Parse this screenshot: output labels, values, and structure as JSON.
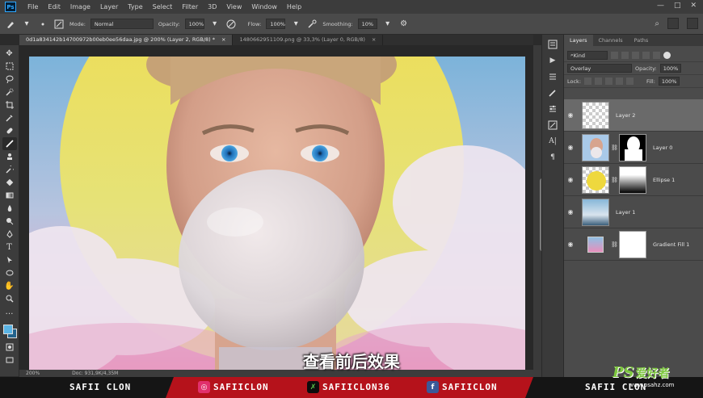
{
  "app": {
    "logo": "Ps"
  },
  "menu": [
    "File",
    "Edit",
    "Image",
    "Layer",
    "Type",
    "Select",
    "Filter",
    "3D",
    "View",
    "Window",
    "Help"
  ],
  "options": {
    "mode_label": "Mode:",
    "mode_value": "Normal",
    "opacity_label": "Opacity:",
    "opacity_value": "100%",
    "flow_label": "Flow:",
    "flow_value": "100%",
    "smoothing_label": "Smoothing:",
    "smoothing_value": "10%"
  },
  "tabs": [
    {
      "label": "0d1a834142b14700972b00eb0ee56daa.jpg @ 200% (Layer 2, RGB/8) *",
      "close": "×"
    },
    {
      "label": "1480662951109.png @ 33,3% (Layer 0, RGB/8)",
      "close": "×"
    }
  ],
  "status": {
    "zoom": "200%",
    "doc": "Doc: 931,9K/4,35M"
  },
  "layers_panel": {
    "tabs": [
      "Layers",
      "Channels",
      "Paths"
    ],
    "kind_label": "Kind",
    "blend_mode": "Overlay",
    "opacity_label": "Opacity:",
    "opacity_value": "100%",
    "lock_label": "Lock:",
    "fill_label": "Fill:",
    "fill_value": "100%",
    "layers": [
      {
        "name": "Layer 2",
        "selected": true
      },
      {
        "name": "Layer 0",
        "selected": false
      },
      {
        "name": "Ellipse 1",
        "selected": false
      },
      {
        "name": "Layer 1",
        "selected": false
      },
      {
        "name": "Gradient Fill 1",
        "selected": false
      }
    ]
  },
  "subtitle": "查看前后效果",
  "banner": {
    "left": "SAFII CLON",
    "instagram": "SAFIICLON",
    "vectary": "SAFIICLON36",
    "facebook": "SAFIICLON",
    "right": "SAFII CLON"
  },
  "watermark": {
    "ps": "PS",
    "cn": "爱好者",
    "url": "www.psahz.com"
  },
  "icons": {
    "toolbar": [
      "move-icon",
      "marquee-icon",
      "lasso-icon",
      "quick-select-icon",
      "crop-icon",
      "eyedropper-icon",
      "healing-icon",
      "brush-icon",
      "stamp-icon",
      "history-brush-icon",
      "eraser-icon",
      "gradient-icon",
      "blur-icon",
      "dodge-icon",
      "pen-icon",
      "type-icon",
      "path-select-icon",
      "shape-icon",
      "hand-icon",
      "zoom-icon"
    ]
  },
  "colors": {
    "foreground": "#5ab4e5",
    "background": "#23638c",
    "banner_red": "#b5121b",
    "watermark_green": "#7ec840"
  }
}
